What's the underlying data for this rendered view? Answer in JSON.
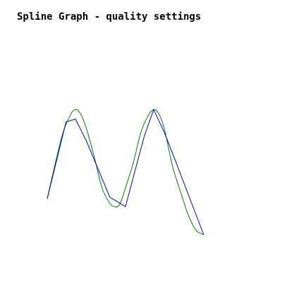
{
  "chart_data": {
    "type": "line",
    "title": "Spline Graph - quality settings",
    "xlabel": "",
    "ylabel": "",
    "grid": false,
    "legend": "none",
    "axes_visible": false,
    "xlim": [
      0,
      100
    ],
    "ylim": [
      0,
      100
    ],
    "series": [
      {
        "key": "spline",
        "color": "#008000",
        "x": [
          0,
          5,
          10,
          15,
          18,
          20,
          22,
          25,
          30,
          35,
          40,
          43,
          45,
          47,
          50,
          55,
          60,
          65,
          68,
          70,
          72,
          75,
          80,
          85,
          90,
          95,
          100
        ],
        "y": [
          23,
          45,
          65,
          77,
          80,
          79,
          76,
          68,
          50,
          30,
          20,
          18,
          18,
          21,
          30,
          46,
          66,
          77,
          80,
          79,
          76,
          67,
          44,
          28,
          13,
          3,
          0
        ]
      },
      {
        "key": "segments",
        "color": "#0000cc",
        "x": [
          0,
          12,
          18,
          25,
          40,
          50,
          62,
          68,
          75,
          82,
          100
        ],
        "y": [
          23,
          72,
          74,
          60,
          24,
          18,
          63,
          80,
          65,
          47,
          0
        ]
      }
    ]
  }
}
